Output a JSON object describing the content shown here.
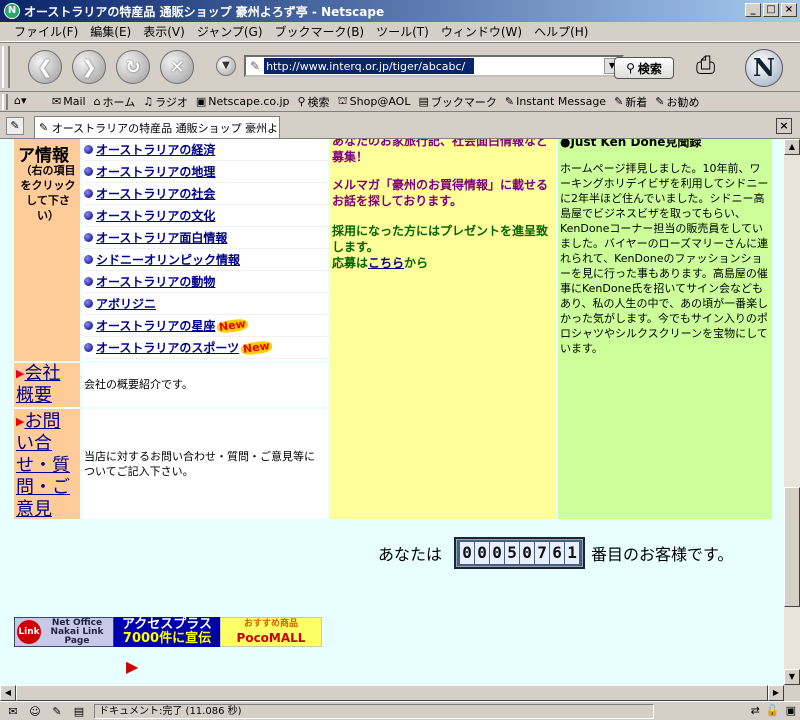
{
  "window": {
    "title": "オーストラリアの特産品  通販ショップ  豪州よろず亭 - Netscape",
    "app_icon_letter": "N",
    "btn_min": "_",
    "btn_max": "□",
    "btn_close": "×"
  },
  "menu": [
    "ファイル(F)",
    "編集(E)",
    "表示(V)",
    "ジャンプ(G)",
    "ブックマーク(B)",
    "ツール(T)",
    "ウィンドウ(W)",
    "ヘルプ(H)"
  ],
  "nav": {
    "back_glyph": "❮",
    "forward_glyph": "❯",
    "reload_glyph": "↻",
    "stop_glyph": "✕",
    "url": "http://www.interq.or.jp/tiger/abcabc/",
    "search_label": "検索",
    "logo_letter": "N"
  },
  "personal_toolbar": [
    {
      "icon": "✉",
      "label": "Mail"
    },
    {
      "icon": "⌂",
      "label": "ホーム"
    },
    {
      "icon": "♫",
      "label": "ラジオ"
    },
    {
      "icon": "▣",
      "label": "Netscape.co.jp"
    },
    {
      "icon": "⚲",
      "label": "検索"
    },
    {
      "icon": "⛫",
      "label": "Shop@AOL"
    },
    {
      "icon": "▤",
      "label": "ブックマーク"
    },
    {
      "icon": "✎",
      "label": "Instant Message"
    },
    {
      "icon": "✎",
      "label": "新着"
    },
    {
      "icon": "✎",
      "label": "お勧め"
    }
  ],
  "tab": {
    "label": "オーストラリアの特産品  通販ショップ  豪州よ..."
  },
  "content": {
    "info_title": "ア情報",
    "info_note": "（右の項目をクリックして下さい）",
    "links": [
      {
        "label": "オーストラリアの経済",
        "new": ""
      },
      {
        "label": "オーストラリアの地理",
        "new": ""
      },
      {
        "label": "オーストラリアの社会",
        "new": ""
      },
      {
        "label": "オーストラリアの文化",
        "new": ""
      },
      {
        "label": "オーストラリア面白情報",
        "new": ""
      },
      {
        "label": "シドニーオリンピック情報",
        "new": ""
      },
      {
        "label": "オーストラリアの動物",
        "new": ""
      },
      {
        "label": "アボリジニ",
        "new": ""
      },
      {
        "label": "オーストラリアの星座",
        "new": "New"
      },
      {
        "label": "オーストラリアのスポーツ",
        "new": "New"
      }
    ],
    "yellow": {
      "line1": "あなたのお家旅行記、社会面白情報など募集！",
      "line2": "メルマガ「豪州のお買得情報」に載せるお話を探しております。",
      "line3": "採用になった方にはプレゼントを進呈致します。",
      "apply_prefix": "応募は",
      "apply_link": "こちら",
      "apply_suffix": "から"
    },
    "green_head": "●Just Ken Done見聞録",
    "green_text": "ホームページ拝見しました。10年前、ワーキングホリデイビザを利用してシドニーに2年半ほど住んでいました。シドニー高島屋でビジネスビザを取ってもらい、KenDoneコーナー担当の販売員をしていました。バイヤーのローズマリーさんに連れられて、KenDoneのファッションショーを見に行った事もあります。高島屋の催事にKenDone氏を招いてサイン会などもあり、私の人生の中で、あの頃が一番楽しかった気がします。今でもサイン入りのポロシャツやシルクスクリーンを宝物にしています。",
    "company": {
      "link": "会社概要",
      "desc": "会社の概要紹介です。"
    },
    "inquiry": {
      "link": "お問い合せ・質問・ご意見",
      "desc": "当店に対するお問い合わせ・質問・ご意見等についてご記入下さい。"
    },
    "visitor_prefix": "あなたは",
    "counter": "00050761",
    "visitor_suffix": "番目のお客様です。",
    "banners": {
      "b1_round": "Link",
      "b1_text": "Net Office Nakai Link Page",
      "b2_line1": "アクセスプラス",
      "b2_line2": "7000件に宣伝",
      "b3_top": "おすすめ商品",
      "b3_bot": "PocoMALL"
    }
  },
  "status": {
    "text": "ドキュメント:完了 (11.086 秒)"
  }
}
